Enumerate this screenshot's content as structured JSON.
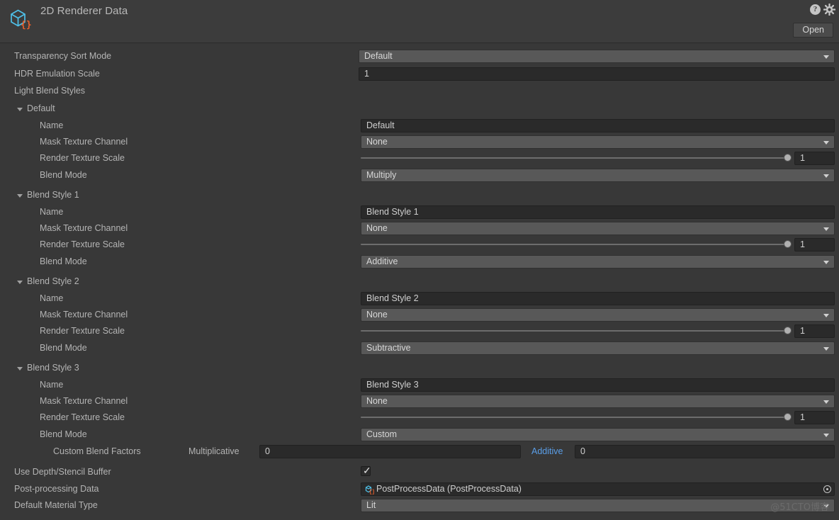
{
  "header": {
    "title": "2D Renderer Data",
    "icon": "scriptable-object-icon",
    "help_label": "?",
    "help_icon": "help-icon",
    "gear_icon": "gear-icon",
    "open_label": "Open"
  },
  "colors": {
    "background": "#383838",
    "header_bg": "#3c3c3c",
    "popup_bg": "#585858",
    "textfield_bg": "#2a2a2a",
    "label": "#b4b4b4",
    "accent_blue": "#5a9ee8",
    "icon_blue": "#4ec0e8",
    "icon_orange": "#e8602c"
  },
  "properties": {
    "transparency_sort_mode": {
      "label": "Transparency Sort Mode",
      "value": "Default"
    },
    "hdr_emulation_scale": {
      "label": "HDR Emulation Scale",
      "value": "1"
    },
    "light_blend_styles": {
      "label": "Light Blend Styles"
    },
    "use_depth_stencil_buffer": {
      "label": "Use Depth/Stencil Buffer",
      "checked": true,
      "tick": "✓"
    },
    "post_processing_data": {
      "label": "Post-processing Data",
      "value": "PostProcessData (PostProcessData)"
    },
    "default_material_type": {
      "label": "Default Material Type",
      "value": "Lit"
    }
  },
  "field_labels": {
    "name": "Name",
    "mask_texture_channel": "Mask Texture Channel",
    "render_texture_scale": "Render Texture Scale",
    "blend_mode": "Blend Mode",
    "custom_blend_factors": "Custom Blend Factors",
    "multiplicative": "Multiplicative",
    "additive": "Additive"
  },
  "blend_styles": [
    {
      "foldout_label": "Default",
      "name": "Default",
      "mask_texture_channel": "None",
      "render_texture_scale": "1",
      "render_texture_scale_pct": 100,
      "blend_mode": "Multiply",
      "has_custom_factors": false
    },
    {
      "foldout_label": "Blend Style 1",
      "name": "Blend Style 1",
      "mask_texture_channel": "None",
      "render_texture_scale": "1",
      "render_texture_scale_pct": 100,
      "blend_mode": "Additive",
      "has_custom_factors": false
    },
    {
      "foldout_label": "Blend Style 2",
      "name": "Blend Style 2",
      "mask_texture_channel": "None",
      "render_texture_scale": "1",
      "render_texture_scale_pct": 100,
      "blend_mode": "Subtractive",
      "has_custom_factors": false
    },
    {
      "foldout_label": "Blend Style 3",
      "name": "Blend Style 3",
      "mask_texture_channel": "None",
      "render_texture_scale": "1",
      "render_texture_scale_pct": 100,
      "blend_mode": "Custom",
      "has_custom_factors": true,
      "multiplicative_value": "0",
      "additive_value": "0"
    }
  ],
  "watermark": "@51CTO博客"
}
